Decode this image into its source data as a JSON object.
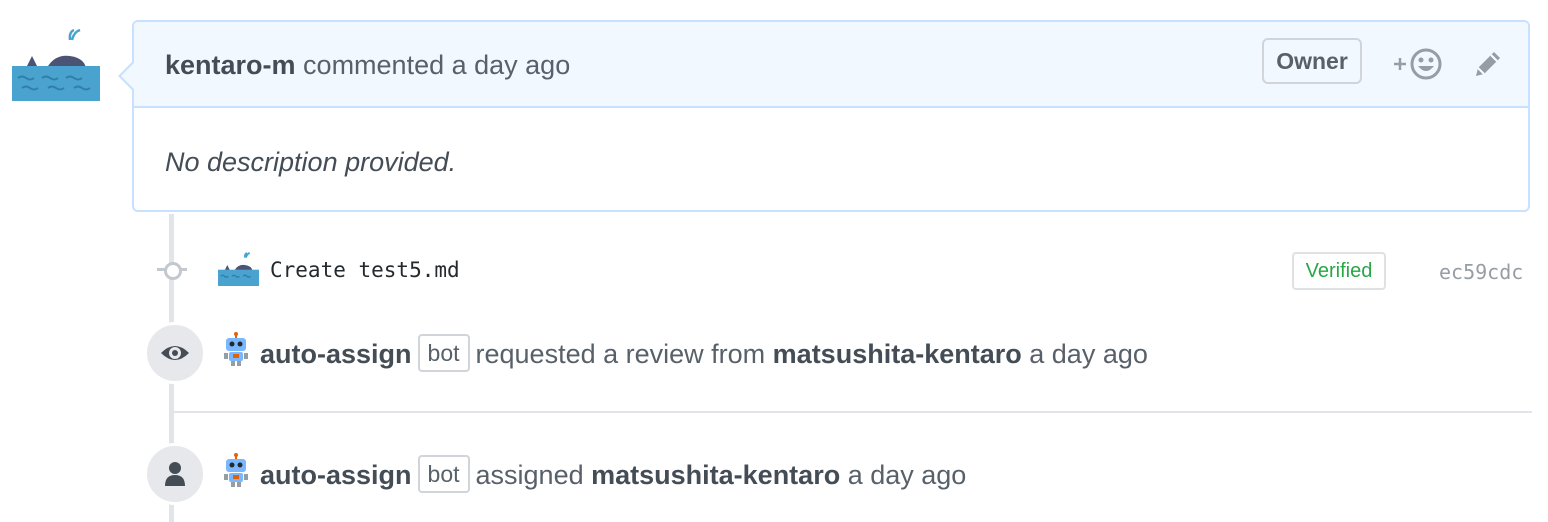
{
  "comment": {
    "author": "kentaro-m",
    "action_text": "commented a day ago",
    "owner_badge": "Owner",
    "body": "No description provided.",
    "react_icon": "add-reaction-icon",
    "edit_icon": "pencil-icon"
  },
  "commit": {
    "message": "Create test5.md",
    "verified_label": "Verified",
    "sha": "ec59cdc",
    "icon": "git-commit-icon"
  },
  "events": [
    {
      "icon": "eye-icon",
      "actor": "auto-assign",
      "bot_label": "bot",
      "action": "requested a review from",
      "target": "matsushita-kentaro",
      "time": "a day ago"
    },
    {
      "icon": "person-icon",
      "actor": "auto-assign",
      "bot_label": "bot",
      "action": "assigned",
      "target": "matsushita-kentaro",
      "time": "a day ago"
    }
  ],
  "colors": {
    "header_bg": "#f1f8ff",
    "header_border": "#c8e1ff",
    "verified": "#28a745",
    "whale_sea": "#4aa3cf"
  }
}
